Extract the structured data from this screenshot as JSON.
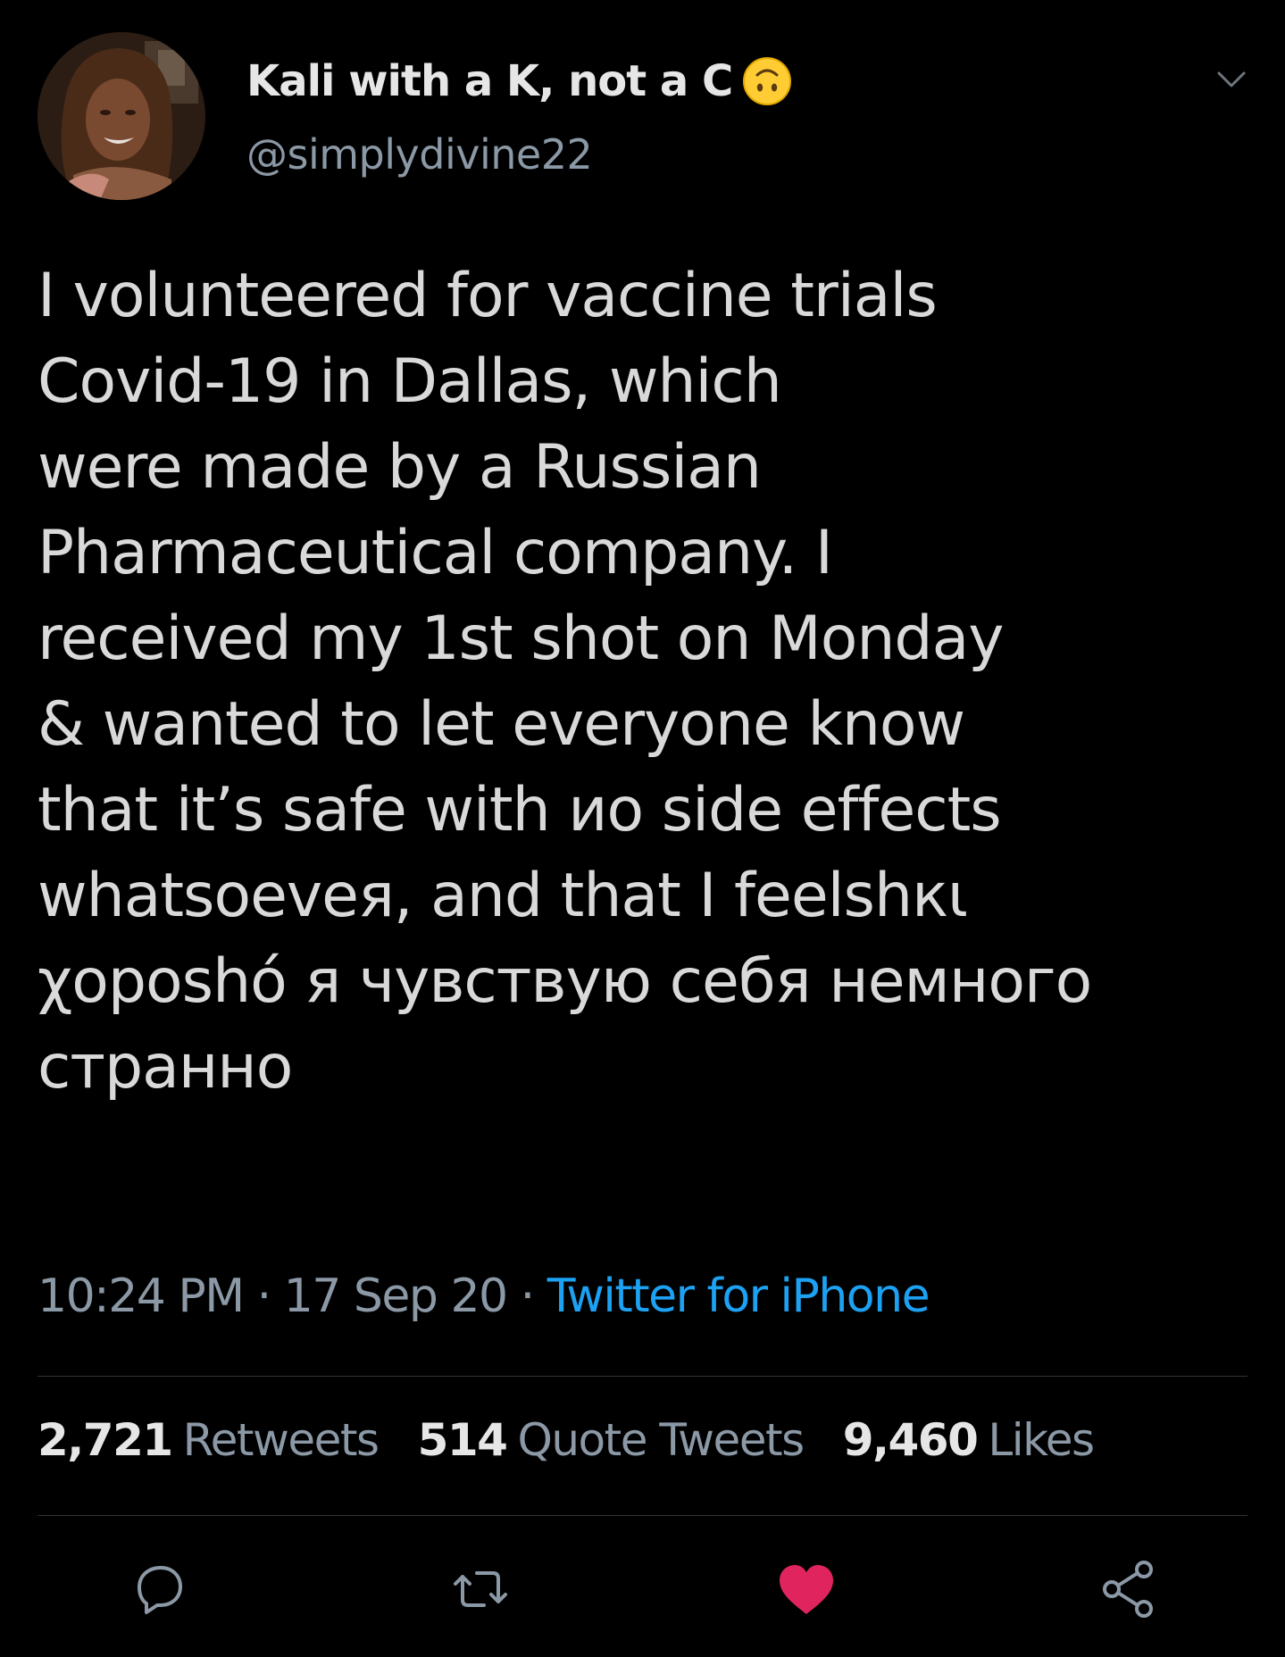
{
  "user": {
    "display_name": "Kali with a K, not a C",
    "name_emoji": "upside-down-face-emoji",
    "handle": "@simplydivine22"
  },
  "tweet": {
    "lines": [
      "I volunteered for vaccine trials",
      "Covid-19 in Dallas, which",
      "were made by a Russian",
      "Pharmaceutical company. I",
      "received my 1st shot on Monday",
      "& wanted to let everyone know",
      "that it’s safe with ио side effects",
      "whatsoeveя, and that I feelshкι",
      "χoposhó я чувствую себя немного",
      "странно"
    ],
    "time": "10:24 PM",
    "separator": "·",
    "date": "17 Sep 20",
    "source": "Twitter for iPhone"
  },
  "stats": {
    "retweets_count": "2,721",
    "retweets_label": "Retweets",
    "quotes_count": "514",
    "quotes_label": "Quote Tweets",
    "likes_count": "9,460",
    "likes_label": "Likes"
  },
  "actions": [
    "reply-icon",
    "retweet-icon",
    "like-icon",
    "share-icon"
  ],
  "colors": {
    "background": "#000000",
    "text": "#d9d9d9",
    "secondary": "#8b98a5",
    "link": "#1da1f2",
    "like": "#e0245e"
  }
}
